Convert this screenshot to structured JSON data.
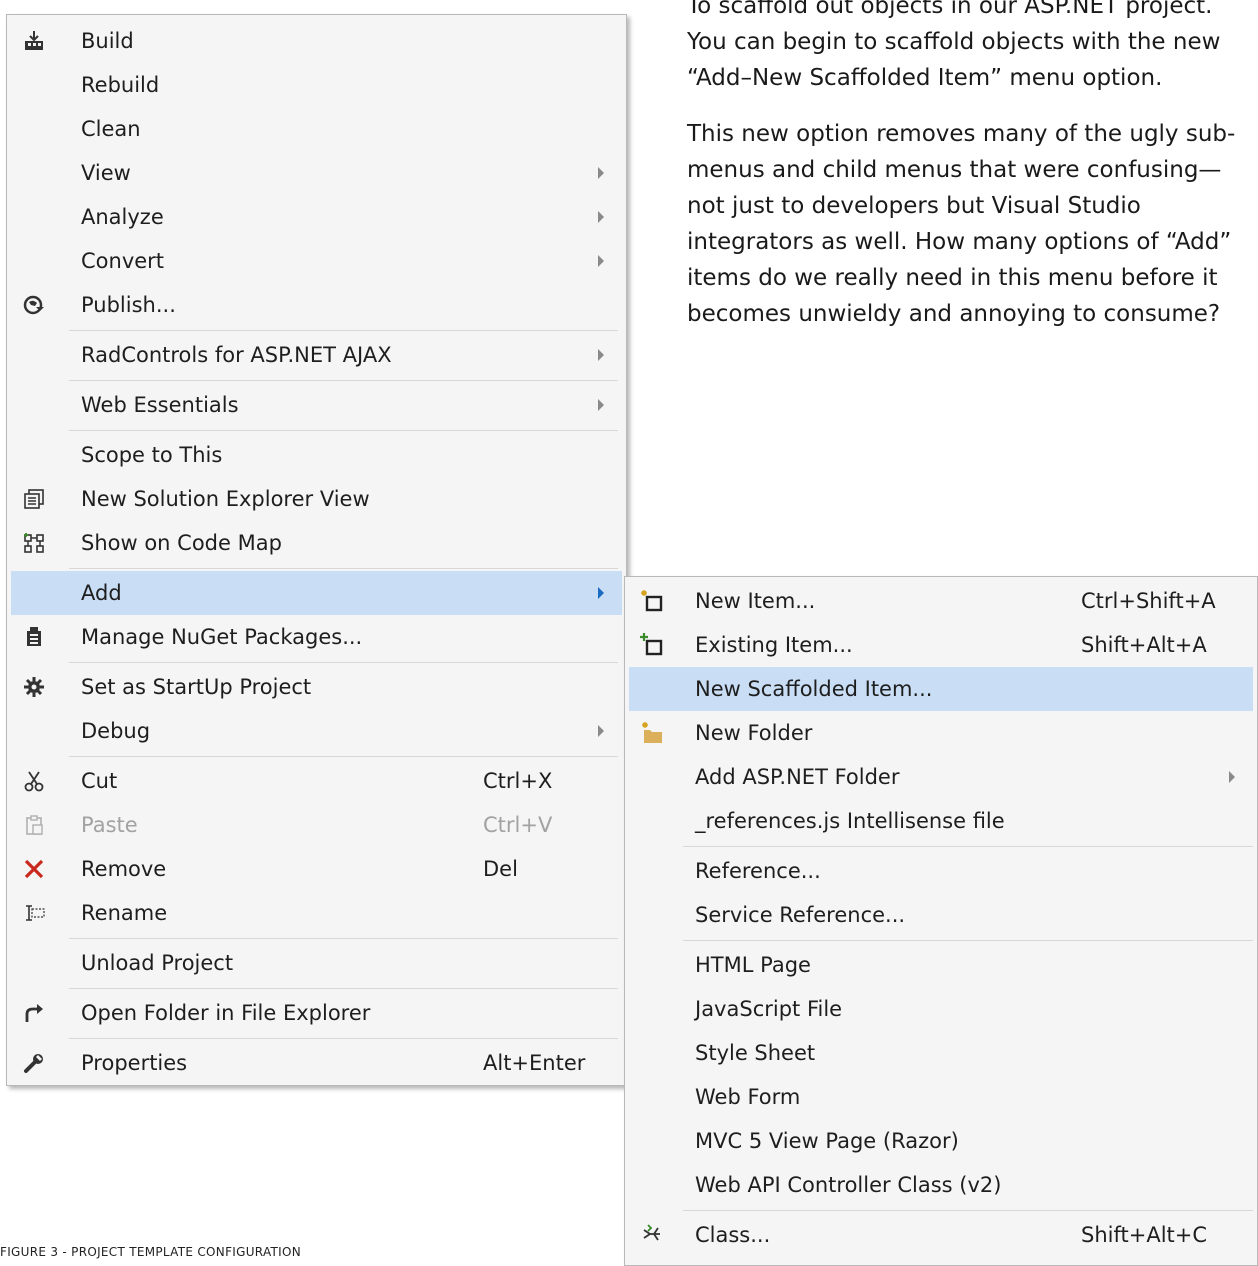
{
  "article": {
    "paragraphs": [
      "To scaffold out objects in our ASP.NET project. You can begin to scaffold objects with the new “Add–New Scaffolded Item” menu option.",
      "This new option removes many of the ugly sub-menus and child menus that were confusing—not just to developers but Visual Studio integrators as well. How many options of “Add” items do we really need in this menu before it becomes unwieldy and annoying to consume?"
    ],
    "caption": "FIGURE 3 - PROJECT TEMPLATE CONFIGURATION"
  },
  "main_menu": {
    "items": [
      {
        "label": "Build",
        "icon": "build-icon"
      },
      {
        "label": "Rebuild"
      },
      {
        "label": "Clean"
      },
      {
        "label": "View",
        "submenu": true
      },
      {
        "label": "Analyze",
        "submenu": true
      },
      {
        "label": "Convert",
        "submenu": true
      },
      {
        "label": "Publish...",
        "icon": "publish-icon"
      },
      {
        "label": "RadControls for ASP.NET AJAX",
        "submenu": true
      },
      {
        "label": "Web Essentials",
        "submenu": true
      },
      {
        "label": "Scope to This"
      },
      {
        "label": "New Solution Explorer View",
        "icon": "solution-explorer-icon"
      },
      {
        "label": "Show on Code Map",
        "icon": "code-map-icon"
      },
      {
        "label": "Add",
        "submenu": true,
        "highlighted": true
      },
      {
        "label": "Manage NuGet Packages...",
        "icon": "nuget-icon"
      },
      {
        "label": "Set as StartUp Project",
        "icon": "gear-icon"
      },
      {
        "label": "Debug",
        "submenu": true
      },
      {
        "label": "Cut",
        "icon": "scissors-icon",
        "shortcut": "Ctrl+X"
      },
      {
        "label": "Paste",
        "icon": "clipboard-icon",
        "shortcut": "Ctrl+V",
        "disabled": true
      },
      {
        "label": "Remove",
        "icon": "remove-x-icon",
        "shortcut": "Del"
      },
      {
        "label": "Rename",
        "icon": "rename-icon"
      },
      {
        "label": "Unload Project"
      },
      {
        "label": "Open Folder in File Explorer",
        "icon": "open-folder-arrow-icon"
      },
      {
        "label": "Properties",
        "icon": "wrench-icon",
        "shortcut": "Alt+Enter"
      }
    ]
  },
  "sub_menu": {
    "items": [
      {
        "label": "New Item...",
        "icon": "new-item-icon",
        "shortcut": "Ctrl+Shift+A"
      },
      {
        "label": "Existing Item...",
        "icon": "existing-item-icon",
        "shortcut": "Shift+Alt+A"
      },
      {
        "label": "New Scaffolded Item...",
        "highlighted": true
      },
      {
        "label": "New Folder",
        "icon": "new-folder-icon"
      },
      {
        "label": "Add ASP.NET Folder",
        "submenu": true
      },
      {
        "label": "_references.js Intellisense file"
      },
      {
        "label": "Reference..."
      },
      {
        "label": "Service Reference..."
      },
      {
        "label": "HTML Page"
      },
      {
        "label": "JavaScript File"
      },
      {
        "label": "Style Sheet"
      },
      {
        "label": "Web Form"
      },
      {
        "label": "MVC 5 View Page (Razor)"
      },
      {
        "label": "Web API Controller Class (v2)"
      },
      {
        "label": "Class...",
        "icon": "class-icon",
        "shortcut": "Shift+Alt+C"
      }
    ]
  },
  "colors": {
    "highlight": "#c9def5",
    "menu_background": "#f5f5f5",
    "remove_icon": "#c8281e",
    "folder_icon": "#dcb05a"
  }
}
